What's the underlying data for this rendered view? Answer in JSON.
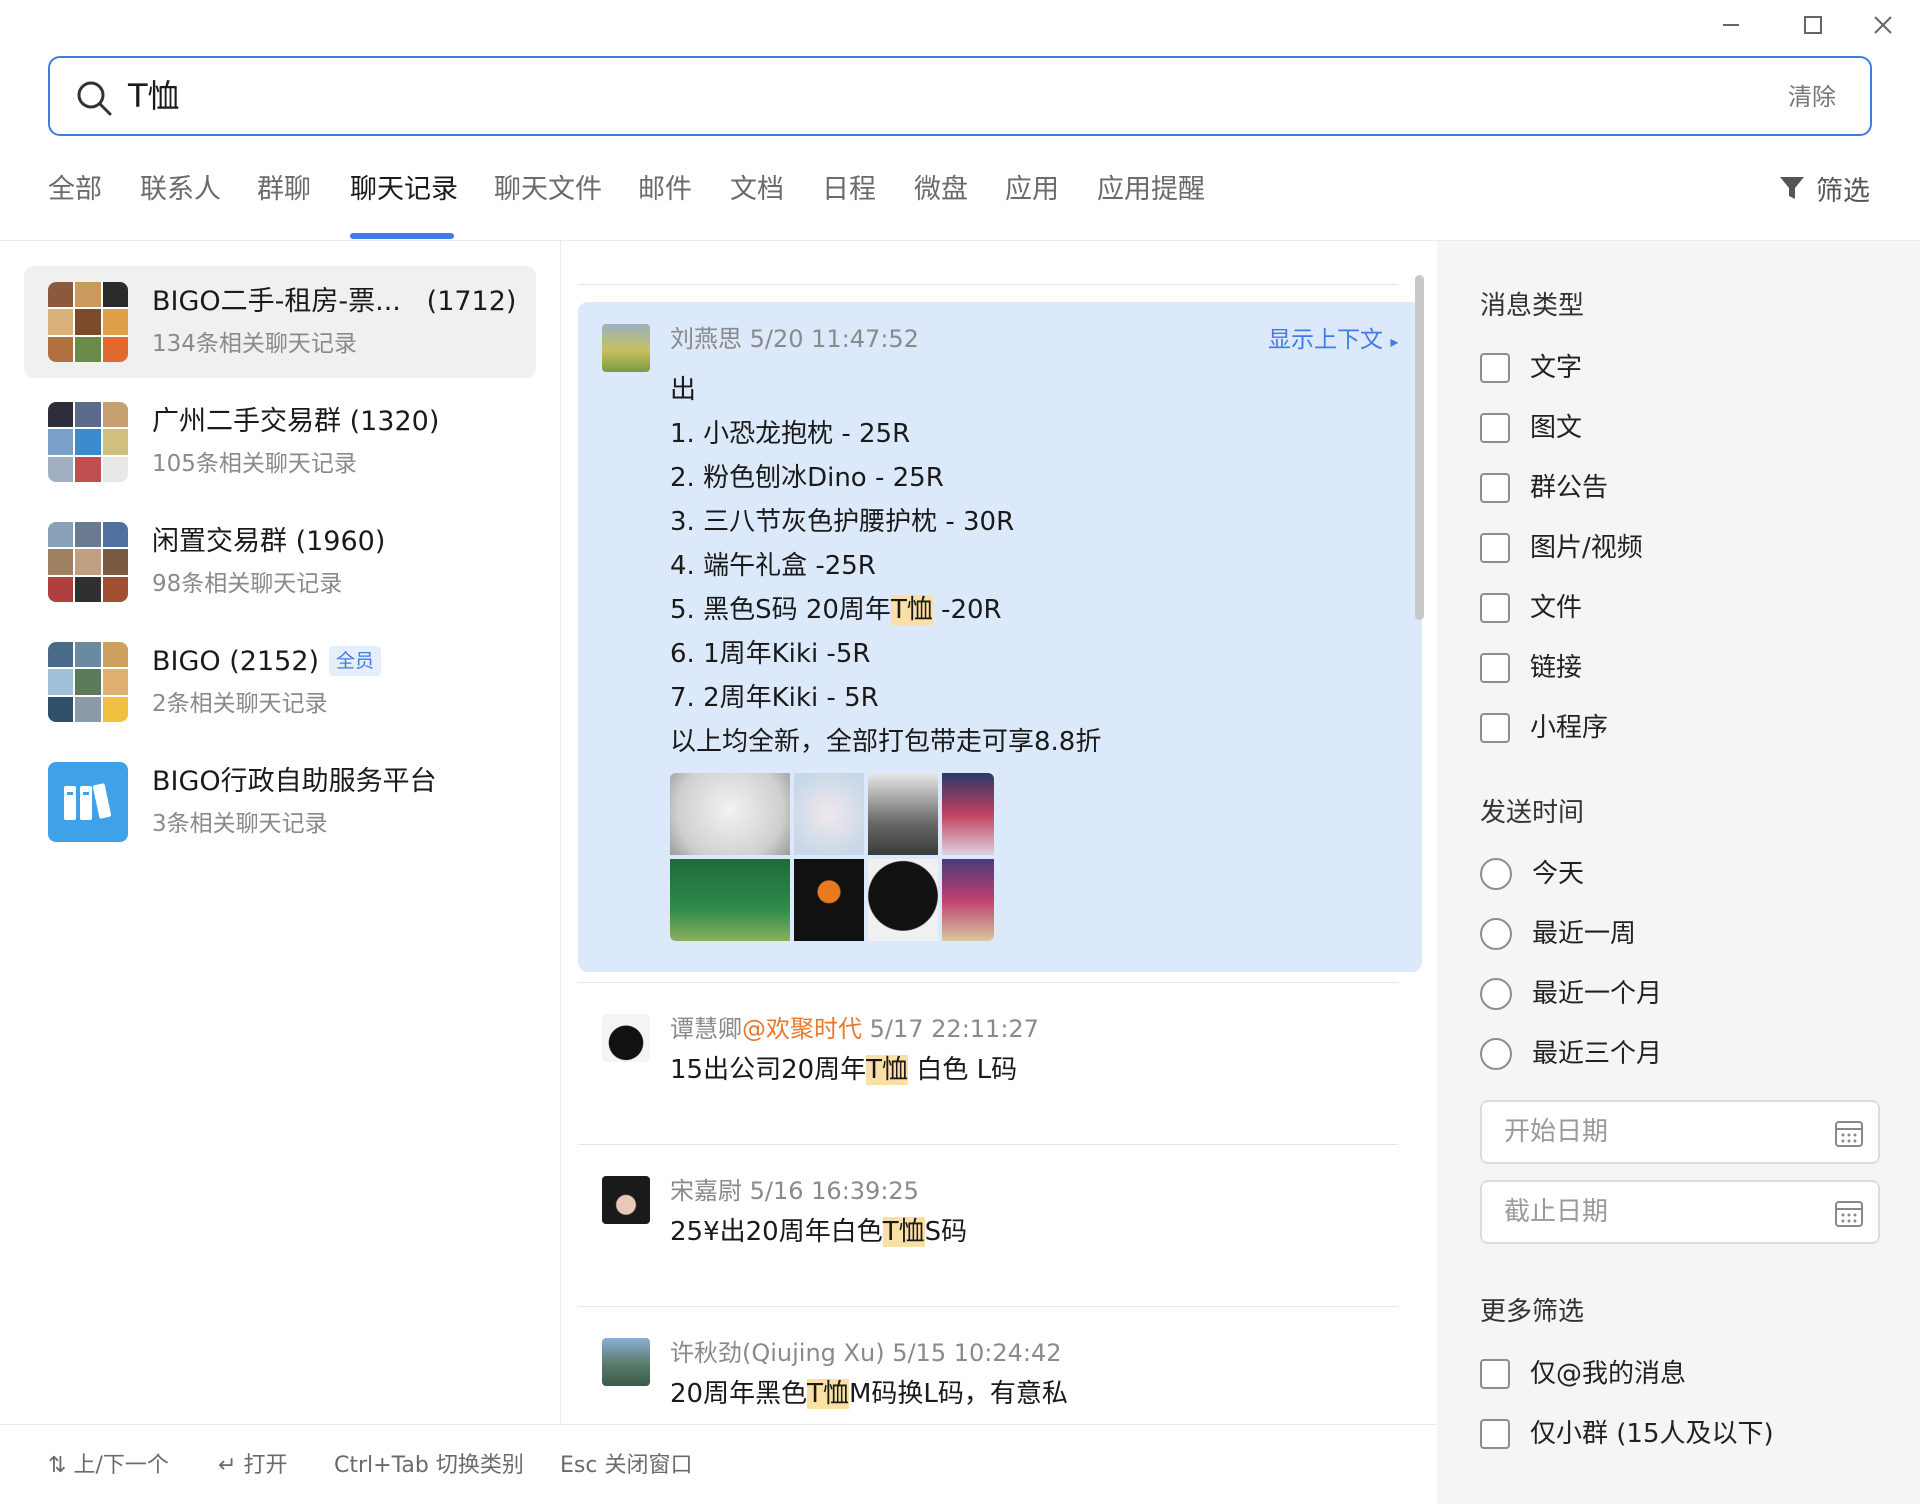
{
  "window": {
    "min_icon": "minimize-icon",
    "max_icon": "maximize-icon",
    "close_icon": "close-icon"
  },
  "search": {
    "query": "T恤",
    "clear_label": "清除",
    "icon": "search-icon"
  },
  "tabs": [
    "全部",
    "联系人",
    "群聊",
    "聊天记录",
    "聊天文件",
    "邮件",
    "文档",
    "日程",
    "微盘",
    "应用",
    "应用提醒"
  ],
  "active_tab": "聊天记录",
  "filter": {
    "label": "筛选",
    "icon": "funnel-icon"
  },
  "conversations": [
    {
      "name": "BIGO二手-租房-票...",
      "count": "(1712)",
      "sub": "134条相关聊天记录",
      "selected": true
    },
    {
      "name": "广州二手交易群",
      "count": "(1320)",
      "sub": "105条相关聊天记录"
    },
    {
      "name": "闲置交易群",
      "count": "(1960)",
      "sub": "98条相关聊天记录"
    },
    {
      "name": "BIGO",
      "count": "(2152)",
      "badge": "全员",
      "sub": "2条相关聊天记录"
    },
    {
      "name": "BIGO行政自助服务平台",
      "count": "",
      "sub": "3条相关聊天记录"
    }
  ],
  "messages": [
    {
      "sender": "刘燕思",
      "time": "5/20 11:47:52",
      "context_link": "显示上下文",
      "lines": [
        {
          "text": "出"
        },
        {
          "text": "1. 小恐龙抱枕 - 25R"
        },
        {
          "text": "2. 粉色刨冰Dino - 25R"
        },
        {
          "text": "3. 三八节灰色护腰护枕 - 30R"
        },
        {
          "text": "4. 端午礼盒 -25R"
        },
        {
          "pre": "5. 黑色S码 20周年",
          "hl": "T恤",
          "post": " -20R"
        },
        {
          "text": "6. 1周年Kiki -5R"
        },
        {
          "text": "7. 2周年Kiki - 5R"
        },
        {
          "text": "以上均全新，全部打包带走可享8.8折"
        }
      ]
    },
    {
      "sender": "谭慧卿",
      "at": "@欢聚时代",
      "time": "5/17 22:11:27",
      "pre": " 15出公司20周年",
      "hl": "T恤",
      "post": " 白色 L码"
    },
    {
      "sender": "宋嘉尉",
      "time": "5/16 16:39:25",
      "pre": "25¥出20周年白色",
      "hl": "T恤",
      "post": "S码"
    },
    {
      "sender": "许秋劲(Qiujing Xu)",
      "time": "5/15 10:24:42",
      "pre": "20周年黑色",
      "hl": "T恤",
      "post": "M码换L码，有意私"
    }
  ],
  "filters": {
    "type_title": "消息类型",
    "types": [
      "文字",
      "图文",
      "群公告",
      "图片/视频",
      "文件",
      "链接",
      "小程序"
    ],
    "time_title": "发送时间",
    "times": [
      "今天",
      "最近一周",
      "最近一个月",
      "最近三个月"
    ],
    "start_placeholder": "开始日期",
    "end_placeholder": "截止日期",
    "more_title": "更多筛选",
    "more": [
      "仅@我的消息",
      "仅小群 (15人及以下)"
    ]
  },
  "footer": {
    "nav": "上/下一个",
    "open": "打开",
    "switch": "Ctrl+Tab 切换类别",
    "close": "Esc 关闭窗口"
  },
  "colors": {
    "accent": "#3f7ce6",
    "selected_msg_bg": "#dce9fb",
    "highlight": "#fbe0a6",
    "mention": "#e8792a"
  }
}
